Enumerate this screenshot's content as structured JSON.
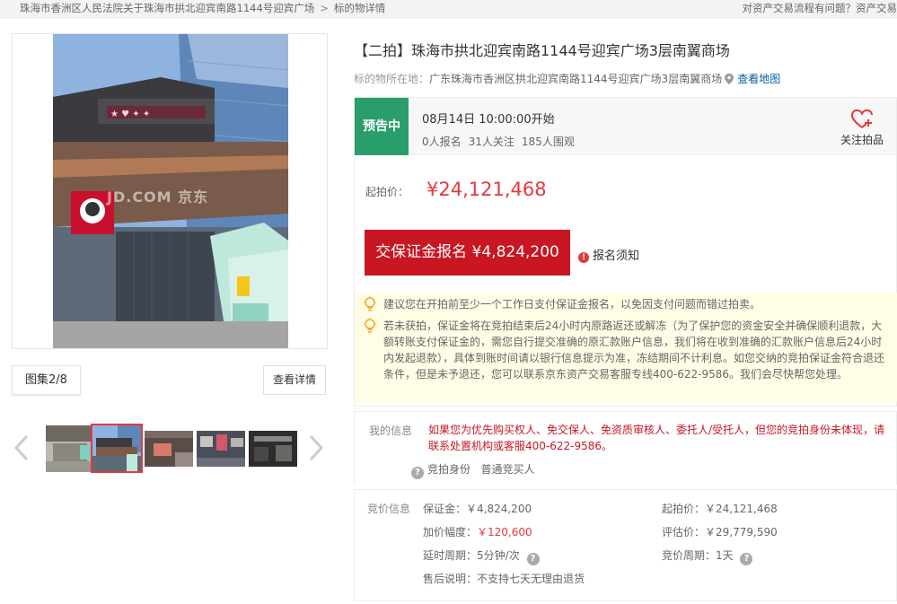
{
  "breadcrumb": {
    "items": [
      "珠海市香洲区人民法院关于珠海市拱北迎宾南路1144号迎宾广场",
      "标的物详情"
    ],
    "separator": ">"
  },
  "topbar": {
    "help_text": "对资产交易流程有问题？资产交易"
  },
  "gallery": {
    "watermark": "JD.COM 京东",
    "counter": "图集2/8",
    "detail_button": "查看详情",
    "prev_icon": "chevron-left-icon",
    "next_icon": "chevron-right-icon",
    "thumbnail_count": 5,
    "selected_thumbnail": 2
  },
  "item": {
    "title": "【二拍】珠海市拱北迎宾南路1144号迎宾广场3层南翼商场",
    "location_label": "标的物所在地：",
    "location_address": "广东珠海市香洲区拱北迎宾南路1144号迎宾广场3层南翼商场",
    "map_link": "查看地图"
  },
  "auction": {
    "status": "预告中",
    "start_time": "08月14日 10:00:00开始",
    "signups": "0人报名",
    "followers": "31人关注",
    "viewers": "185人围观",
    "follow_label": "关注拍品",
    "start_price_label": "起拍价：",
    "start_price": "¥24,121,468",
    "deposit_button": "交保证金报名 ¥4,824,200",
    "notice_link": "报名须知",
    "colors": {
      "status_green": "#2a9d6c",
      "accent_red": "#c81623",
      "price_red": "#e4393c"
    }
  },
  "tips": [
    "建议您在开拍前至少一个工作日支付保证金报名，以免因支付问题而错过拍卖。",
    "若未获拍，保证金将在竞拍结束后24小时内原路返还或解冻（为了保护您的资金安全并确保顺利退款，大额转账支付保证金的，需您自行提交准确的原汇款账户信息，我们将在收到准确的汇款账户信息后24小时内发起退款），具体到账时间请以银行信息提示为准，冻结期间不计利息。如您交纳的竞拍保证金符合退还条件，但是未予退还，您可以联系京东资产交易客服专线400-622-9586。我们会尽快帮您处理。"
  ],
  "my_info": {
    "label": "我的信息",
    "warning": "如果您为优先购买权人、免交保人、免资质审核人、委托人/受托人，但您的竞拍身份未体现，请联系处置机构或客服400-622-9586。",
    "identity_label": "竞拍身份",
    "identity_value": "普通竞买人"
  },
  "bid_info": {
    "label": "竞价信息",
    "deposit_label": "保证金：",
    "deposit_value": "￥4,824,200",
    "increment_label": "加价幅度：",
    "increment_value": "￥120,600",
    "delay_label": "延时周期：",
    "delay_value": "5分钟/次",
    "aftersale_label": "售后说明：",
    "aftersale_value": "不支持七天无理由退货",
    "start_label": "起拍价：",
    "start_value": "￥24,121,468",
    "appraisal_label": "评估价：",
    "appraisal_value": "￥29,779,590",
    "cycle_label": "竞价周期：",
    "cycle_value": "1天"
  }
}
